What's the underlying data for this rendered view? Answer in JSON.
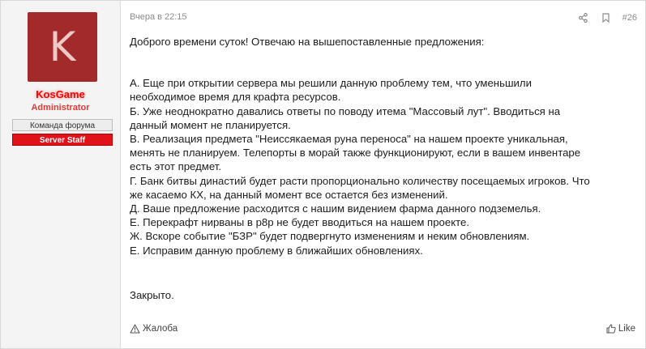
{
  "user": {
    "avatar_letter": "K",
    "name": "KosGame",
    "title": "Administrator",
    "banners": [
      "Команда форума",
      "Server Staff"
    ],
    "colors": {
      "avatar_bg": "#a32a2a",
      "name": "#ff0000",
      "staff_banner": "#e0121a"
    }
  },
  "post": {
    "date": "Вчера в 22:15",
    "number": "#26",
    "icons": [
      "share-icon",
      "bookmark-icon"
    ],
    "greeting": "Доброго времени суток! Отвечаю на вышепоставленные предложения:",
    "lines": [
      "А. Еще при открытии сервера мы решили данную проблему тем, что уменьшили",
      "необходимое время для крафта ресурсов.",
      "Б. Уже неоднократно давались ответы по поводу итема \"Массовый лут\". Вводиться на",
      "данный момент не планируется.",
      "В. Реализация предмета \"Неиссякаемая руна переноса\" на нашем проекте уникальная,",
      "менять не планируем. Телепорты в морай также функционируют, если в вашем инвентаре",
      "есть этот предмет.",
      "Г. Банк битвы династий будет расти пропорционально количеству посещаемых игроков. Что",
      "же касаемо КХ, на данный момент все остается без изменений.",
      "Д. Ваше предложение расходится с нашим видением фарма данного подземелья.",
      "Е. Перекрафт нирваны в р8р не будет вводиться на нашем проекте.",
      "Ж. Вскоре событие \"БЗР\" будет подвергнуто изменениям и неким обновлениям.",
      "Е. Исправим данную проблему в ближайших обновлениях."
    ],
    "closing": "Закрыто."
  },
  "footer": {
    "report_label": "Жалоба",
    "like_label": "Like"
  }
}
